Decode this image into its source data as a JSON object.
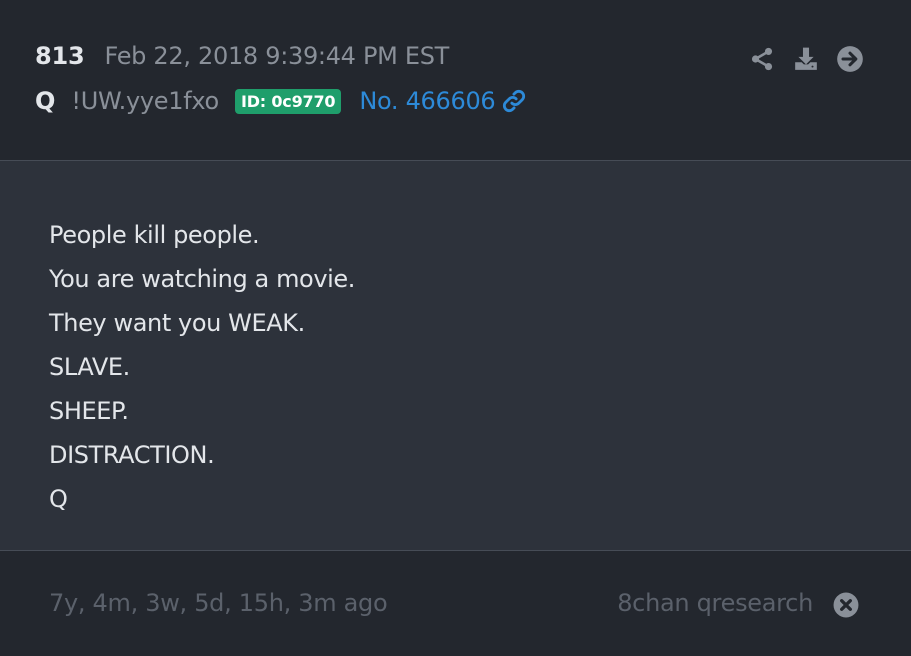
{
  "post": {
    "number": "813",
    "date": "Feb 22, 2018 9:39:44 PM EST",
    "author": "Q",
    "tripcode": "!UW.yye1fxo",
    "id_badge": "ID: 0c9770",
    "post_link": "No. 466606",
    "lines": [
      "People kill people.",
      "You are watching a movie.",
      "They want you WEAK.",
      "SLAVE.",
      "SHEEP.",
      "DISTRACTION.",
      "Q"
    ]
  },
  "footer": {
    "age": "7y, 4m, 3w, 5d, 15h, 3m ago",
    "source": "8chan qresearch"
  },
  "icons": {
    "share": "share-icon",
    "download": "download-icon",
    "goto": "arrow-circle-right-icon",
    "link": "link-icon",
    "close": "close-circle-icon"
  },
  "colors": {
    "header_bg": "#23272e",
    "body_bg": "#2d323b",
    "accent_link": "#2d8ad8",
    "id_badge_bg": "#1f9e6b",
    "muted_text": "#8a9099",
    "footer_text": "#5b616b"
  }
}
